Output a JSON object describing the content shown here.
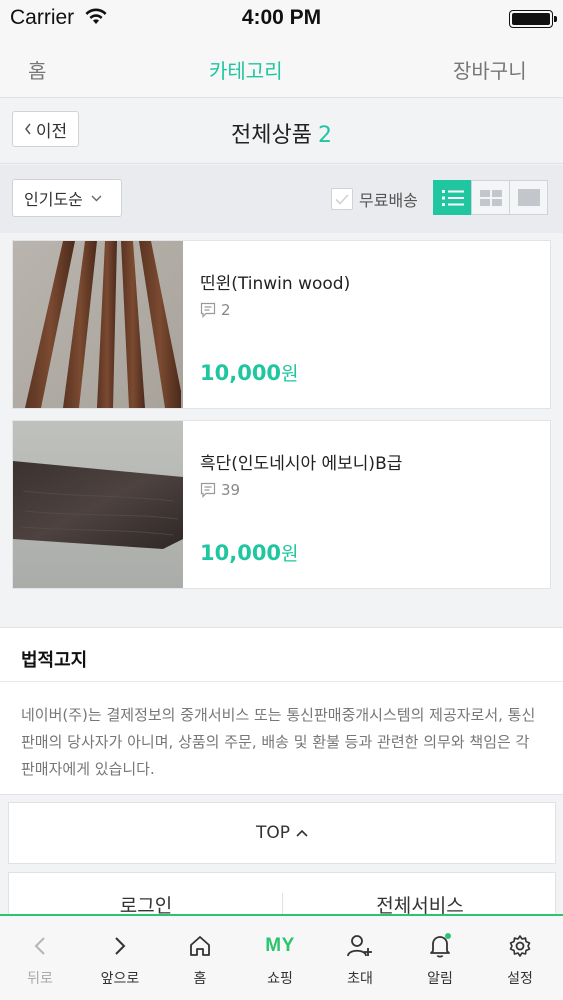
{
  "status_bar": {
    "carrier": "Carrier",
    "time": "4:00 PM"
  },
  "top_tabs": [
    {
      "label": "홈",
      "active": false
    },
    {
      "label": "카테고리",
      "active": true
    },
    {
      "label": "장바구니",
      "active": false
    }
  ],
  "header": {
    "back_label": "이전",
    "title": "전체상품",
    "count": "2"
  },
  "filters": {
    "sort_label": "인기도순",
    "free_shipping_label": "무료배송",
    "views": [
      "list-view-icon",
      "grid-view-icon",
      "gallery-view-icon"
    ],
    "active_view": "list"
  },
  "products": [
    {
      "name": "띤윈(Tinwin wood)",
      "reviews": "2",
      "price": "10,000",
      "currency": "원"
    },
    {
      "name": "흑단(인도네시아 에보니)B급",
      "reviews": "39",
      "price": "10,000",
      "currency": "원"
    }
  ],
  "legal": {
    "title": "법적고지",
    "text": "네이버(주)는 결제정보의 중개서비스 또는 통신판매중개시스템의 제공자로서, 통신판매의 당사자가 아니며, 상품의 주문, 배송 및 환불 등과 관련한 의무와 책임은 각 판매자에게 있습니다."
  },
  "top_button_label": "TOP",
  "footer_links": [
    "로그인",
    "전체서비스"
  ],
  "bottom_nav": [
    {
      "label": "뒤로",
      "icon": "back-arrow-icon",
      "enabled": false
    },
    {
      "label": "앞으로",
      "icon": "forward-arrow-icon",
      "enabled": true
    },
    {
      "label": "홈",
      "icon": "home-icon",
      "enabled": true
    },
    {
      "label": "쇼핑",
      "icon_text": "MY",
      "enabled": true
    },
    {
      "label": "초대",
      "icon": "invite-person-icon",
      "enabled": true
    },
    {
      "label": "알림",
      "icon": "bell-icon",
      "enabled": true
    },
    {
      "label": "설정",
      "icon": "gear-icon",
      "enabled": true
    }
  ],
  "colors": {
    "accent": "#1fc6a0",
    "nav_accent": "#2bc56f"
  }
}
